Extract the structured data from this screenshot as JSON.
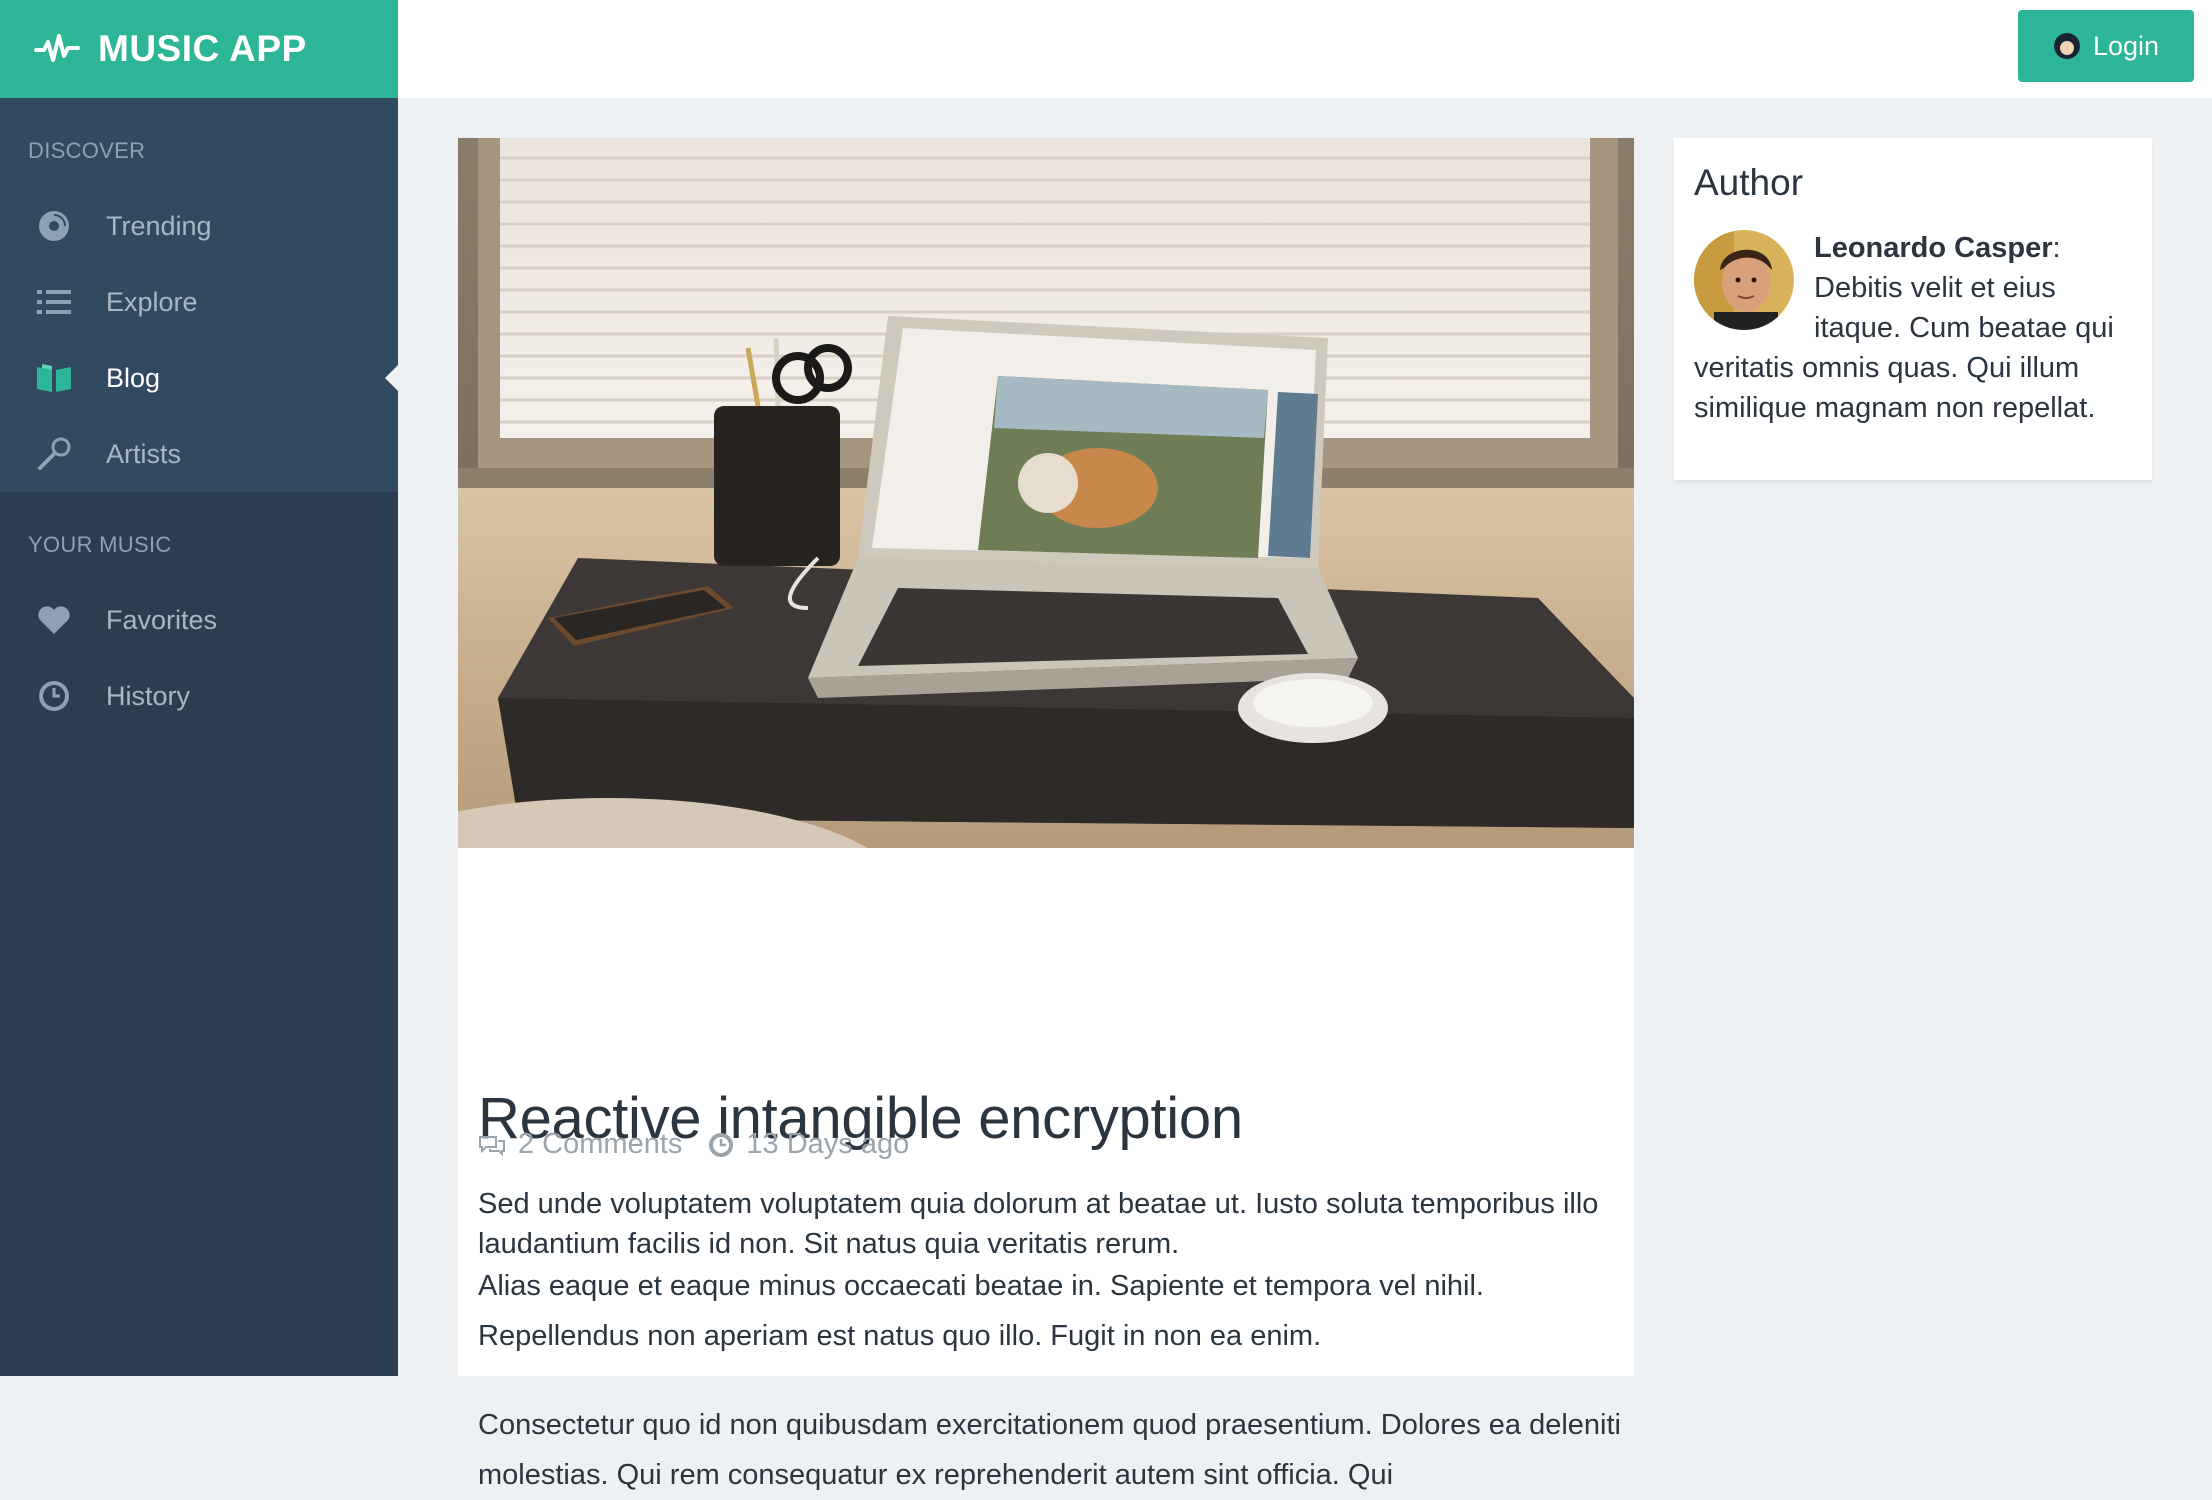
{
  "app": {
    "title": "MUSIC APP"
  },
  "sidebar": {
    "sections": [
      {
        "label": "DISCOVER"
      },
      {
        "label": "YOUR MUSIC"
      }
    ],
    "discover_items": [
      {
        "label": "Trending",
        "icon": "disc-icon"
      },
      {
        "label": "Explore",
        "icon": "list-icon"
      },
      {
        "label": "Blog",
        "icon": "book-icon",
        "active": true
      },
      {
        "label": "Artists",
        "icon": "microphone-icon"
      }
    ],
    "music_items": [
      {
        "label": "Favorites",
        "icon": "heart-icon"
      },
      {
        "label": "History",
        "icon": "clock-icon"
      }
    ]
  },
  "header": {
    "login_label": "Login"
  },
  "article": {
    "title": "Reactive intangible encryption",
    "comments": "2 Comments",
    "posted": "13 Days ago",
    "paragraph1_line1": "Sed unde voluptatem voluptatem quia dolorum at beatae ut. Iusto soluta temporibus illo laudantium facilis id non. Sit natus quia veritatis rerum.",
    "paragraph1_line2": " Alias eaque et eaque minus occaecati beatae in. Sapiente et tempora vel nihil.",
    "paragraph1_line3": "Repellendus non aperiam est natus quo illo. Fugit in non ea enim.",
    "paragraph2": "Consectetur quo id non quibusdam exercitationem quod praesentium. Dolores ea deleniti molestias. Qui rem consequatur ex reprehenderit autem sint officia. Qui"
  },
  "author": {
    "heading": "Author",
    "name": "Leonardo Casper",
    "bio": "Debitis velit et eius itaque. Cum beatae qui veritatis omnis quas. Qui illum similique magnam non repellat."
  },
  "colors": {
    "accent": "#2cb596",
    "sidebar": "#2b3e50",
    "sidebar_section": "#324a5f"
  }
}
